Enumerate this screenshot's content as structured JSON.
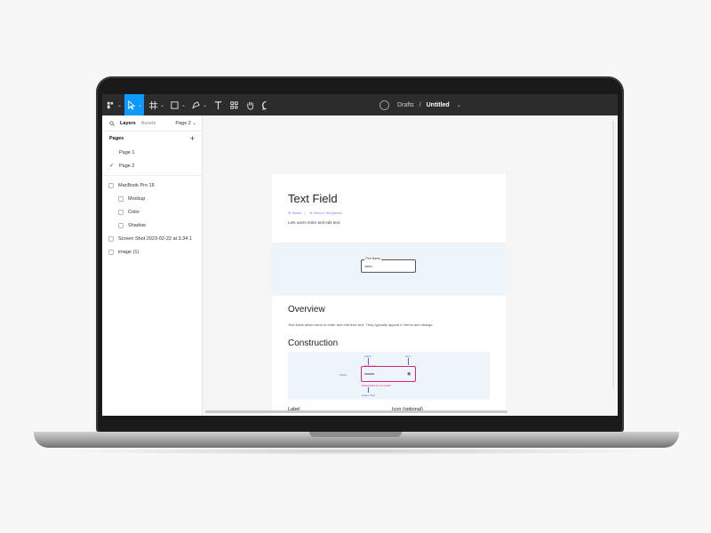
{
  "toolbar": {
    "breadcrumb_parent": "Drafts",
    "breadcrumb_sep": "/",
    "file_title": "Untitled",
    "caret": "⌄"
  },
  "panel": {
    "tabs": {
      "layers": "Layers",
      "assets": "Assets",
      "page_selector": "Page 2 ⌄"
    },
    "pages_header": "Pages",
    "add_page": "+",
    "pages": [
      {
        "label": "Page 1",
        "checked": ""
      },
      {
        "label": "Page 2",
        "checked": "✓"
      }
    ],
    "layers": [
      {
        "label": "MacBook Pro 16"
      },
      {
        "label": "Mockup"
      },
      {
        "label": "Color"
      },
      {
        "label": "Shadow"
      },
      {
        "label": "Screen Shot 2023-02-22 at 3.34 1"
      },
      {
        "label": "image (1)"
      }
    ]
  },
  "doc": {
    "title": "Text Field",
    "links": {
      "share": "⊕ Share",
      "storybook": "⊕ View in Storybook",
      "sep": "|"
    },
    "description": "Lets users enter and edit text.",
    "demo_field": {
      "label": "First Name",
      "value": "John"
    },
    "overview_heading": "Overview",
    "overview_text": "Text fields allow users to enter and edit their text. They typically appear in forms and dialogs.",
    "construction_heading": "Construction",
    "construction": {
      "label": "Label",
      "icon": "Icon",
      "active": "Active",
      "field_label": "Password",
      "dots": "••••••••••••",
      "error": "Passwords do not match",
      "helper": "Helper Text"
    },
    "footer_label_left": "Label",
    "footer_label_right": "Icon (optional)"
  },
  "colors": {
    "accent": "#0d99ff",
    "toolbar_bg": "#2c2c2c",
    "error": "#e0226e",
    "annotation": "#5b5bdc"
  }
}
